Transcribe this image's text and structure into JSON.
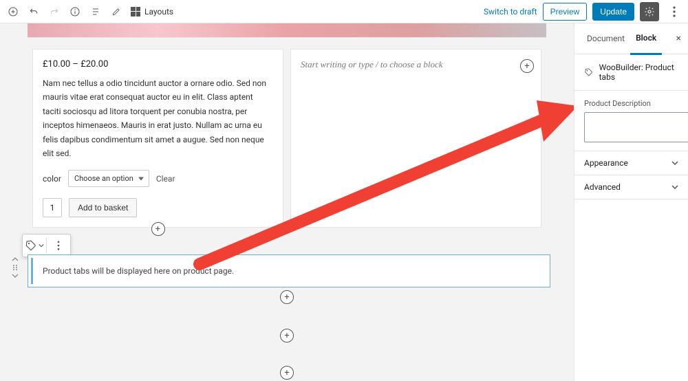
{
  "topbar": {
    "layouts_label": "Layouts",
    "switch_draft": "Switch to draft",
    "preview": "Preview",
    "update": "Update"
  },
  "product": {
    "price": "£10.00 – £20.00",
    "description": "Nam nec tellus a odio tincidunt auctor a ornare odio. Sed non mauris vitae erat consequat auctor eu in elit. Class aptent taciti sociosqu ad litora torquent per conubia nostra, per inceptos himenaeos. Mauris in erat justo. Nullam ac urna eu felis dapibus condimentum sit amet a augue. Sed non neque elit sed.",
    "attr_label": "color",
    "select_placeholder": "Choose an option",
    "clear": "Clear",
    "qty": "1",
    "add_to_basket": "Add to basket"
  },
  "col2": {
    "placeholder": "Start writing or type / to choose a block"
  },
  "tabs_notice": "Product tabs will be displayed here on product page.",
  "sidebar": {
    "tab_document": "Document",
    "tab_block": "Block",
    "block_title": "WooBuilder: Product tabs",
    "field_label": "Product Description",
    "appearance": "Appearance",
    "advanced": "Advanced"
  }
}
